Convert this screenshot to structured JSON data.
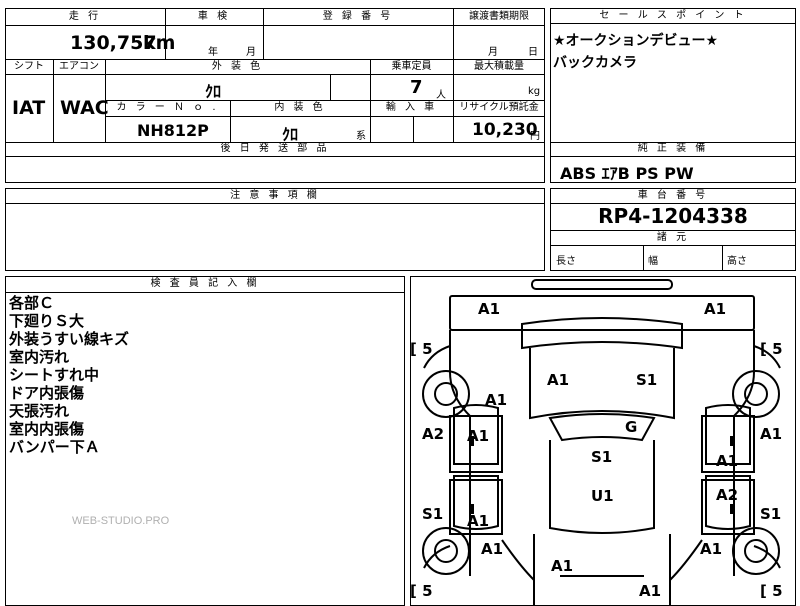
{
  "top": {
    "mileage_label": "走 行",
    "shaken_label": "車 検",
    "reg_label": "登 録 番 号",
    "transfer_label": "譲渡書類期限",
    "mileage_value": "130,757",
    "mileage_unit": "km",
    "shaken_year": "年",
    "shaken_month": "月",
    "transfer_month": "月",
    "transfer_day": "日"
  },
  "row2": {
    "shift_label": "シフト",
    "ac_label": "エアコン",
    "ext_color_label": "外 装 色",
    "capacity_label": "乗車定員",
    "load_label": "最大積載量",
    "shift_value": "IAT",
    "ac_value": "WAC",
    "ext_color_value": "ｸﾛ",
    "capacity_value": "7",
    "capacity_unit": "人",
    "load_unit": "kg",
    "color_no_label": "カ ラ ー Ｎ ｏ .",
    "int_color_label": "内 装 色",
    "import_label": "輸 入 車",
    "recycle_label": "リサイクル預託金",
    "color_no_value": "NH812P",
    "int_color_value": "ｸﾛ",
    "int_color_suffix": "系",
    "recycle_value": "10,230",
    "recycle_unit": "円"
  },
  "parts": {
    "label": "後 日 発 送 部 品"
  },
  "notes": {
    "label": "注 意 事 項 欄"
  },
  "sales": {
    "label": "セ ー ル ス ポ イ ン ト",
    "line1": "★オークションデビュー★",
    "line2": "バックカメラ"
  },
  "equip": {
    "label": "純 正 装 備",
    "value": "ABS ｴｱB PS PW"
  },
  "chassis": {
    "label": "車 台 番 号",
    "value": "RP4-1204338"
  },
  "dims": {
    "label": "諸 元",
    "length": "長さ",
    "width": "幅",
    "height": "高さ"
  },
  "inspector": {
    "label": "検 査 員 記 入 欄",
    "remarks": [
      "各部Ｃ",
      "下廻りＳ大",
      "外装うすい線キズ",
      "室内汚れ",
      "シートすれ中",
      "ドア内張傷",
      "天張汚れ",
      "室内内張傷",
      "バンパー下Ａ"
    ],
    "watermark": "WEB-STUDIO.PRO"
  },
  "diagram": {
    "marks": {
      "front_left": "A1",
      "front_right": "A1",
      "hood_left": "A1",
      "hood_right": "S1",
      "left_fender": "A1",
      "windshield": "G",
      "left_quarter_front": "A2",
      "left_front_door": "A1",
      "roof_front": "S1",
      "right_front_door": "A1",
      "right_quarter_front": "A1",
      "roof_rear": "U1",
      "right_rear_door": "A2",
      "left_rear_door": "A1",
      "left_rocker": "S1",
      "right_rocker": "S1",
      "left_rear_fender": "A1",
      "right_rear_fender": "A1",
      "rear_left": "A1",
      "rear_right": "A1"
    },
    "tires": {
      "front_left": "5",
      "front_right": "5",
      "rear_left": "5",
      "rear_right": "5"
    }
  }
}
